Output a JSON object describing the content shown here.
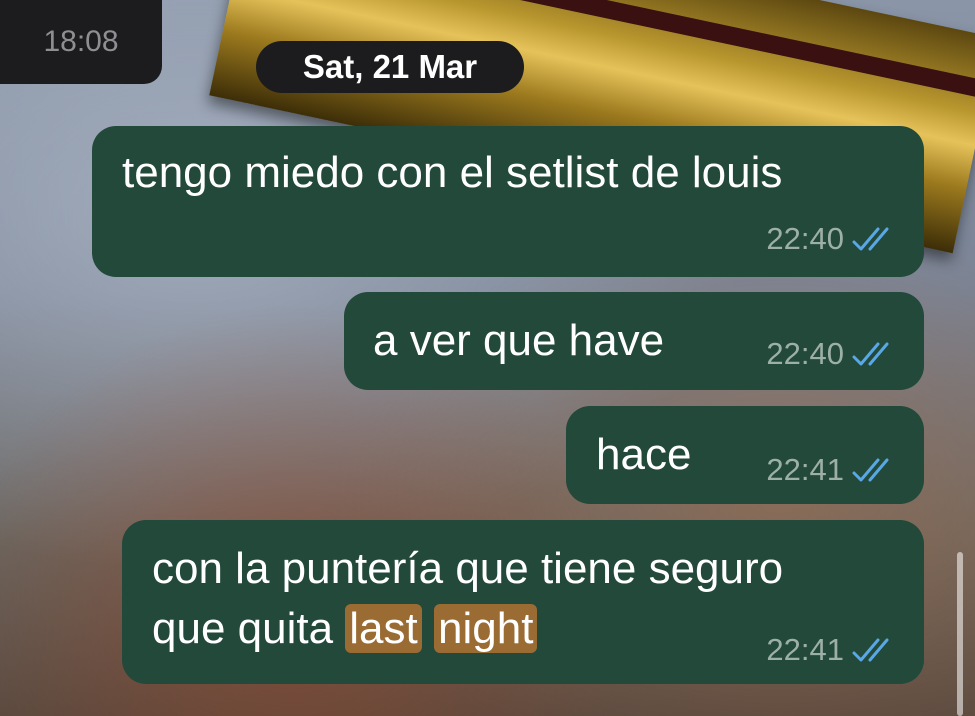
{
  "top_time": "18:08",
  "date_separator": "Sat, 21 Mar",
  "messages": [
    {
      "text": "tengo miedo con el setlist de louis",
      "time": "22:40",
      "status": "read"
    },
    {
      "text": "a ver que have",
      "time": "22:40",
      "status": "read"
    },
    {
      "text": "hace",
      "time": "22:41",
      "status": "read"
    },
    {
      "text_line1": "con la puntería que tiene seguro",
      "text_line2_prefix": "que quita ",
      "highlight_1": "last",
      "highlight_2": "night",
      "time": "22:41",
      "status": "read"
    }
  ],
  "colors": {
    "bubble": "#22493a",
    "highlight": "#9a6c34",
    "read_ticks": "#5aa7e6",
    "pill": "#1c1c1e"
  },
  "icons": {
    "read_receipt": "double-check-icon"
  }
}
